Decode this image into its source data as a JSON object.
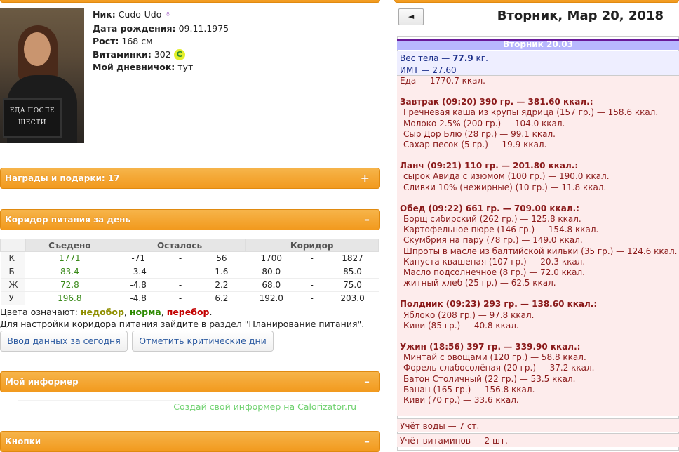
{
  "profile": {
    "nick_label": "Ник:",
    "nick": "Cudo-Udo",
    "birth_label": "Дата рождения:",
    "birth": "09.11.1975",
    "height_label": "Рост:",
    "height": "168 см",
    "vitamins_label": "Витаминки:",
    "vitamins": "302",
    "vitamins_coin": "C",
    "diary_label": "Мой дневничок:",
    "diary_link": "тут",
    "photo_sign_line1": "ЕДА ПОСЛЕ",
    "photo_sign_line2": "ШЕСТИ"
  },
  "panels": {
    "awards": "Награды и подарки: 17",
    "awards_toggle": "+",
    "corridor": "Коридор питания за день",
    "corridor_toggle": "–",
    "informer": "Мой информер",
    "informer_toggle": "–",
    "buttons": "Кнопки",
    "buttons_toggle": "–"
  },
  "corridor_table": {
    "headers": [
      "",
      "Съедено",
      "Осталось",
      "Коридор"
    ],
    "rows": [
      {
        "label": "К",
        "eaten": "1771",
        "left_a": "-71",
        "sep1": "-",
        "left_b": "56",
        "cor_a": "1700",
        "sep2": "-",
        "cor_b": "1827"
      },
      {
        "label": "Б",
        "eaten": "83.4",
        "left_a": "-3.4",
        "sep1": "-",
        "left_b": "1.6",
        "cor_a": "80.0",
        "sep2": "-",
        "cor_b": "85.0"
      },
      {
        "label": "Ж",
        "eaten": "72.8",
        "left_a": "-4.8",
        "sep1": "-",
        "left_b": "2.2",
        "cor_a": "68.0",
        "sep2": "-",
        "cor_b": "75.0"
      },
      {
        "label": "У",
        "eaten": "196.8",
        "left_a": "-4.8",
        "sep1": "-",
        "left_b": "6.2",
        "cor_a": "192.0",
        "sep2": "-",
        "cor_b": "203.0"
      }
    ]
  },
  "legend": {
    "prefix": "Цвета означают:",
    "under": "недобор",
    "comma1": ",",
    "norm": "норма",
    "comma2": ",",
    "over": "перебор",
    "dot": ".",
    "hint": "Для настройки коридора питания зайдите в раздел \"Планирование питания\"."
  },
  "actions": {
    "enter_today": "Ввод данных за сегодня",
    "mark_critical": "Отметить критические дни"
  },
  "informer_link": "Создай свой информер на Calorizator.ru",
  "diary": {
    "prev": "◄",
    "date": "Вторник, Мар 20, 2018",
    "day_bar": "Вторник 20.03",
    "weight_label": "Вес тела —",
    "weight_value": "77.9",
    "weight_unit": "кг.",
    "bmi_label": "ИМТ —",
    "bmi_value": "27.60",
    "food_total": "Еда — 1770.7 ккал.",
    "meals": [
      {
        "title": "Завтрак (09:20) 390 гр. — 381.60 ккал.:",
        "items": [
          "Гречневая каша из крупы ядрица (157 гр.) — 158.6 ккал.",
          "Молоко 2.5% (200 гр.) — 104.0 ккал.",
          "Сыр Дор Блю (28 гр.) — 99.1 ккал.",
          "Сахар-песок (5 гр.) — 19.9 ккал."
        ]
      },
      {
        "title": "Ланч (09:21) 110 гр. — 201.80 ккал.:",
        "items": [
          "сырок Авида с изюмом (100 гр.) — 190.0 ккал.",
          "Сливки 10% (нежирные) (10 гр.) — 11.8 ккал."
        ]
      },
      {
        "title": "Обед (09:22) 661 гр. — 709.00 ккал.:",
        "items": [
          "Борщ сибирский (262 гр.) — 125.8 ккал.",
          "Картофельное пюре (146 гр.) — 154.8 ккал.",
          "Скумбрия на пару (78 гр.) — 149.0 ккал.",
          "Шпроты в масле из балтийской кильки (35 гр.) — 124.6 ккал.",
          "Капуста квашеная (107 гр.) — 20.3 ккал.",
          "Масло подсолнечное (8 гр.) — 72.0 ккал.",
          "житный хлеб (25 гр.) — 62.5 ккал."
        ]
      },
      {
        "title": "Полдник (09:23) 293 гр. — 138.60 ккал.:",
        "items": [
          "Яблоко (208 гр.) — 97.8 ккал.",
          "Киви (85 гр.) — 40.8 ккал."
        ]
      },
      {
        "title": "Ужин (18:56) 397 гр. — 339.90 ккал.:",
        "items": [
          "Минтай с овощами (120 гр.) — 58.8 ккал.",
          "Форель слабосолёная (20 гр.) — 37.2 ккал.",
          "Батон Столичный (22 гр.) — 53.5 ккал.",
          "Банан (165 гр.) — 156.8 ккал.",
          "Киви (70 гр.) — 33.6 ккал."
        ]
      }
    ],
    "water": "Учёт воды — 7 ст.",
    "vitamins": "Учёт витаминов — 2 шт."
  }
}
